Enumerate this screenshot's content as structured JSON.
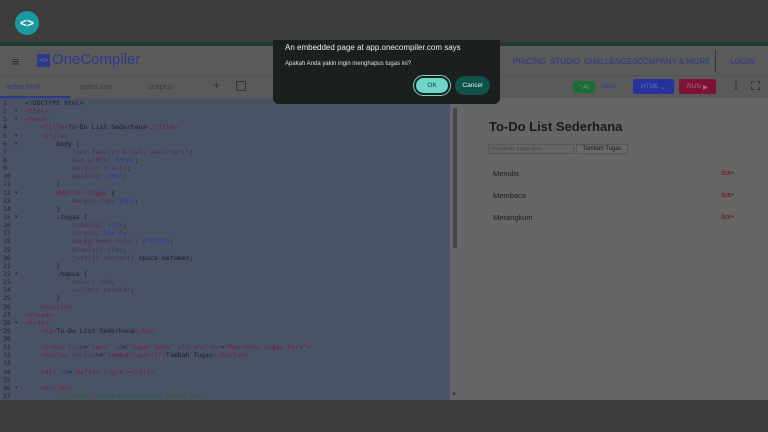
{
  "window": {
    "logo_icon": "onecompiler-app-icon"
  },
  "nav": {
    "brand": "OneCompiler",
    "links": [
      "PRICING",
      "STUDIO",
      "CHALLENGES",
      "COMPANY & MORE"
    ],
    "login": "LOGIN"
  },
  "tabs": [
    "index.html",
    "styles.css",
    "script.js"
  ],
  "toolbar": {
    "ai": "AI",
    "new": "NEW",
    "language": "HTML",
    "run": "RUN"
  },
  "colors": {
    "ai": "#1e6b35",
    "html": "#27339a",
    "run": "#7f1238",
    "dialog_ok": "#6fd6c6",
    "dialog_cancel": "#0f5249"
  },
  "editor": {
    "lines": [
      {
        "n": "1",
        "fold": false,
        "seg": [
          [
            "x",
            "<!DOCTYPE html>"
          ]
        ]
      },
      {
        "n": "2",
        "fold": true,
        "seg": [
          [
            "t",
            "<html>"
          ]
        ]
      },
      {
        "n": "3",
        "fold": true,
        "seg": [
          [
            "t",
            "<head>"
          ]
        ]
      },
      {
        "n": "4",
        "fold": false,
        "seg": [
          [
            "x",
            "    "
          ],
          [
            "t",
            "<title>"
          ],
          [
            "x",
            "To-Do List Sederhana"
          ],
          [
            "t",
            "</title>"
          ]
        ]
      },
      {
        "n": "5",
        "fold": true,
        "seg": [
          [
            "x",
            "    "
          ],
          [
            "t",
            "<style>"
          ]
        ]
      },
      {
        "n": "6",
        "fold": true,
        "seg": [
          [
            "x",
            "        body {"
          ]
        ]
      },
      {
        "n": "7",
        "fold": false,
        "seg": [
          [
            "x",
            "            "
          ],
          [
            "p",
            "font-family"
          ],
          [
            "x",
            ": "
          ],
          [
            "p",
            "Arial"
          ],
          [
            "x",
            ", "
          ],
          [
            "p",
            "sans-serif"
          ],
          [
            "x",
            ";"
          ]
        ]
      },
      {
        "n": "8",
        "fold": false,
        "seg": [
          [
            "x",
            "            "
          ],
          [
            "p",
            "max-width"
          ],
          [
            "x",
            ": "
          ],
          [
            "n",
            "500px"
          ],
          [
            "x",
            ";"
          ]
        ]
      },
      {
        "n": "9",
        "fold": false,
        "seg": [
          [
            "x",
            "            "
          ],
          [
            "p",
            "margin"
          ],
          [
            "x",
            ": "
          ],
          [
            "n",
            "0"
          ],
          [
            "x",
            " "
          ],
          [
            "p",
            "auto"
          ],
          [
            "x",
            ";"
          ]
        ]
      },
      {
        "n": "10",
        "fold": false,
        "seg": [
          [
            "x",
            "            "
          ],
          [
            "p",
            "padding"
          ],
          [
            "x",
            ": "
          ],
          [
            "n",
            "20px"
          ],
          [
            "x",
            ";"
          ]
        ]
      },
      {
        "n": "11",
        "fold": false,
        "seg": [
          [
            "x",
            "        }"
          ]
        ]
      },
      {
        "n": "12",
        "fold": true,
        "seg": [
          [
            "x",
            "        "
          ],
          [
            "t",
            "#daftar-tugas"
          ],
          [
            "x",
            " {"
          ]
        ]
      },
      {
        "n": "13",
        "fold": false,
        "seg": [
          [
            "x",
            "            "
          ],
          [
            "p",
            "margin-top"
          ],
          [
            "x",
            ": "
          ],
          [
            "n",
            "20px"
          ],
          [
            "x",
            ";"
          ]
        ]
      },
      {
        "n": "14",
        "fold": false,
        "seg": [
          [
            "x",
            "        }"
          ]
        ]
      },
      {
        "n": "15",
        "fold": true,
        "seg": [
          [
            "x",
            "        .tugas {"
          ]
        ]
      },
      {
        "n": "16",
        "fold": false,
        "seg": [
          [
            "x",
            "            "
          ],
          [
            "p",
            "padding"
          ],
          [
            "x",
            ": "
          ],
          [
            "n",
            "10px"
          ],
          [
            "x",
            ";"
          ]
        ]
      },
      {
        "n": "17",
        "fold": false,
        "seg": [
          [
            "x",
            "            "
          ],
          [
            "p",
            "margin"
          ],
          [
            "x",
            ": "
          ],
          [
            "n",
            "5px 0"
          ],
          [
            "x",
            ";"
          ]
        ]
      },
      {
        "n": "18",
        "fold": false,
        "seg": [
          [
            "x",
            "            "
          ],
          [
            "p",
            "background-color"
          ],
          [
            "x",
            ": "
          ],
          [
            "n",
            "#f9f9f9"
          ],
          [
            "x",
            ";"
          ]
        ]
      },
      {
        "n": "19",
        "fold": false,
        "seg": [
          [
            "x",
            "            "
          ],
          [
            "p",
            "display"
          ],
          [
            "x",
            ": "
          ],
          [
            "p",
            "flex"
          ],
          [
            "x",
            ";"
          ]
        ]
      },
      {
        "n": "20",
        "fold": false,
        "seg": [
          [
            "x",
            "            "
          ],
          [
            "p",
            "justify-content"
          ],
          [
            "x",
            ": space-between;"
          ]
        ]
      },
      {
        "n": "21",
        "fold": false,
        "seg": [
          [
            "x",
            "        }"
          ]
        ]
      },
      {
        "n": "22",
        "fold": true,
        "seg": [
          [
            "x",
            "        .hapus {"
          ]
        ]
      },
      {
        "n": "23",
        "fold": false,
        "seg": [
          [
            "x",
            "            "
          ],
          [
            "p",
            "color"
          ],
          [
            "x",
            ": "
          ],
          [
            "p",
            "red"
          ],
          [
            "x",
            ";"
          ]
        ]
      },
      {
        "n": "24",
        "fold": false,
        "seg": [
          [
            "x",
            "            "
          ],
          [
            "p",
            "cursor"
          ],
          [
            "x",
            ": "
          ],
          [
            "p",
            "pointer"
          ],
          [
            "x",
            ";"
          ]
        ]
      },
      {
        "n": "25",
        "fold": false,
        "seg": [
          [
            "x",
            "        }"
          ]
        ]
      },
      {
        "n": "26",
        "fold": false,
        "seg": [
          [
            "x",
            "    "
          ],
          [
            "t",
            "</style>"
          ]
        ]
      },
      {
        "n": "27",
        "fold": false,
        "seg": [
          [
            "t",
            "</head>"
          ]
        ]
      },
      {
        "n": "28",
        "fold": true,
        "seg": [
          [
            "t",
            "<body>"
          ]
        ]
      },
      {
        "n": "29",
        "fold": false,
        "seg": [
          [
            "x",
            "    "
          ],
          [
            "t",
            "<h2>"
          ],
          [
            "x",
            "To-Do List Sederhana"
          ],
          [
            "t",
            "</h2>"
          ]
        ]
      },
      {
        "n": "30",
        "fold": false,
        "seg": []
      },
      {
        "n": "31",
        "fold": false,
        "seg": [
          [
            "x",
            "    "
          ],
          [
            "t",
            "<input "
          ],
          [
            "a",
            "type"
          ],
          [
            "x",
            "="
          ],
          [
            "s",
            "\"text\""
          ],
          [
            "x",
            " "
          ],
          [
            "a",
            "id"
          ],
          [
            "x",
            "="
          ],
          [
            "s",
            "\"tugas-baru\""
          ],
          [
            "x",
            " "
          ],
          [
            "a",
            "placeholder"
          ],
          [
            "x",
            "="
          ],
          [
            "s",
            "\"Masukkan tugas baru\""
          ],
          [
            "t",
            ">"
          ]
        ]
      },
      {
        "n": "32",
        "fold": false,
        "seg": [
          [
            "x",
            "    "
          ],
          [
            "t",
            "<button "
          ],
          [
            "a",
            "onclick"
          ],
          [
            "x",
            "="
          ],
          [
            "s",
            "\"tambahTugas()\""
          ],
          [
            "t",
            ">"
          ],
          [
            "x",
            "Tambah Tugas"
          ],
          [
            "t",
            "</button>"
          ]
        ]
      },
      {
        "n": "33",
        "fold": false,
        "seg": []
      },
      {
        "n": "34",
        "fold": false,
        "seg": [
          [
            "x",
            "    "
          ],
          [
            "t",
            "<div "
          ],
          [
            "a",
            "id"
          ],
          [
            "x",
            "="
          ],
          [
            "s",
            "\"daftar-tugas\""
          ],
          [
            "t",
            "></div>"
          ]
        ]
      },
      {
        "n": "35",
        "fold": false,
        "seg": []
      },
      {
        "n": "36",
        "fold": true,
        "seg": [
          [
            "x",
            "    "
          ],
          [
            "t",
            "<script>"
          ]
        ]
      },
      {
        "n": "37",
        "fold": false,
        "seg": [
          [
            "x",
            "        "
          ],
          [
            "c",
            "// Fungsi untuk menambahkan tugas baru"
          ]
        ]
      }
    ]
  },
  "preview": {
    "title": "To-Do List Sederhana",
    "input_placeholder": "Masukkan tugas baru",
    "add_button": "Tambah Tugas",
    "items": [
      {
        "label": "Menulis",
        "delete": "âœ•"
      },
      {
        "label": "Membaca",
        "delete": "âœ•"
      },
      {
        "label": "Merangkum",
        "delete": "âœ•"
      }
    ]
  },
  "dialog": {
    "title": "An embedded page at app.onecompiler.com says",
    "message": "Apakah Anda yakin ingin menghapus tugas ini?",
    "ok": "OK",
    "cancel": "Cancel"
  }
}
